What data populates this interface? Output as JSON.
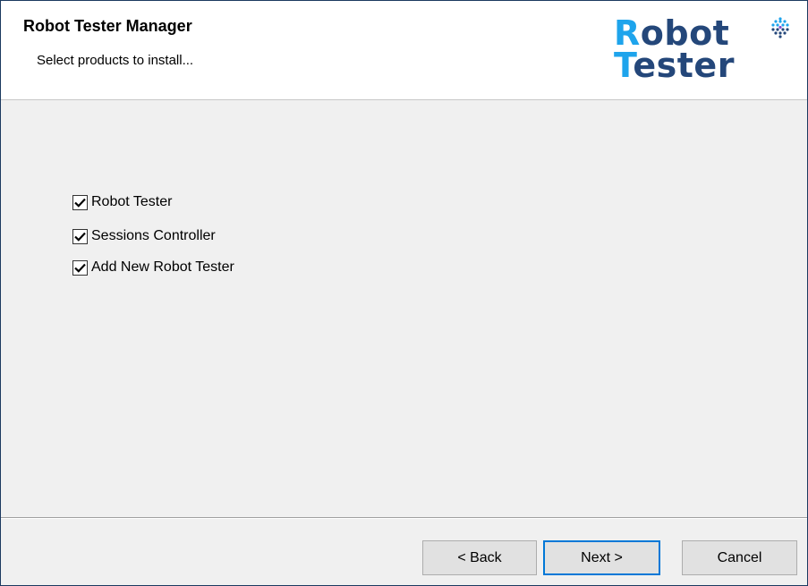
{
  "header": {
    "title": "Robot Tester Manager",
    "subtitle": "Select products to install..."
  },
  "logo": {
    "line1_first": "R",
    "line1_rest": "obot",
    "line2_first": "T",
    "line2_rest": "ester",
    "colors": {
      "accent": "#1ea4ec",
      "dark": "#24477a"
    }
  },
  "products": [
    {
      "label": "Robot Tester",
      "checked": true
    },
    {
      "label": "Sessions Controller",
      "checked": true
    },
    {
      "label": "Add New Robot Tester",
      "checked": true
    }
  ],
  "buttons": {
    "back": "< Back",
    "next": "Next >",
    "cancel": "Cancel"
  }
}
